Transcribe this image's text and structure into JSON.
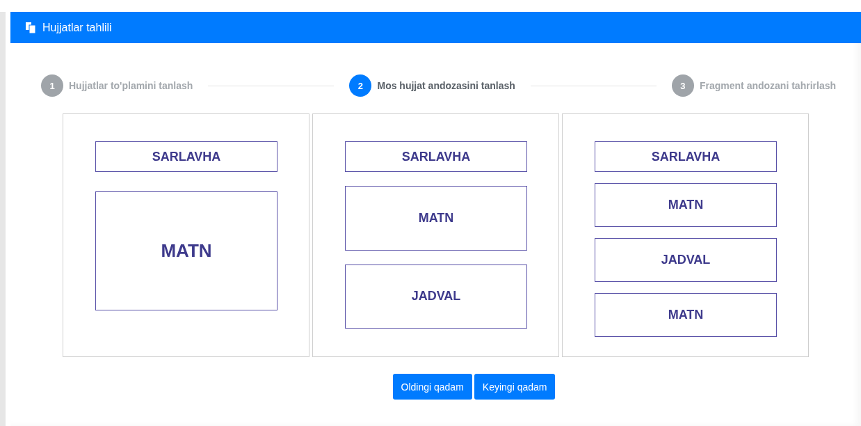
{
  "header": {
    "title": "Hujjatlar tahlili"
  },
  "steps": [
    {
      "number": "1",
      "label": "Hujjatlar to'plamini tanlash",
      "selected": false
    },
    {
      "number": "2",
      "label": "Mos hujjat andozasini tanlash",
      "selected": true
    },
    {
      "number": "3",
      "label": "Fragment andozani tahrirlash",
      "selected": false
    }
  ],
  "templates": [
    {
      "blocks": [
        {
          "kind": "header",
          "label": "SARLAVHA"
        },
        {
          "kind": "text",
          "label": "MATN"
        }
      ]
    },
    {
      "blocks": [
        {
          "kind": "header",
          "label": "SARLAVHA"
        },
        {
          "kind": "text",
          "label": "MATN"
        },
        {
          "kind": "table",
          "label": "JADVAL"
        }
      ]
    },
    {
      "blocks": [
        {
          "kind": "header",
          "label": "SARLAVHA"
        },
        {
          "kind": "text",
          "label": "MATN"
        },
        {
          "kind": "table",
          "label": "JADVAL"
        },
        {
          "kind": "text",
          "label": "MATN"
        }
      ]
    }
  ],
  "buttons": [
    "Oldingi qadam",
    "Keyingi qadam"
  ]
}
